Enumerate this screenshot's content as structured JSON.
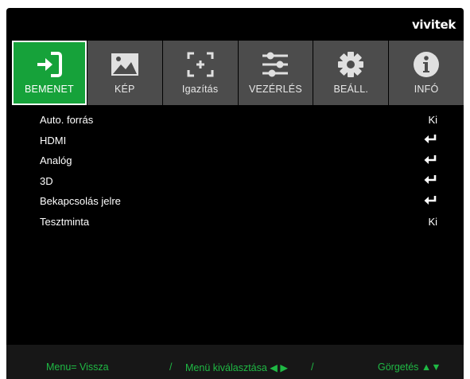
{
  "brand": "vivitek",
  "tabs": [
    {
      "label": "BEMENET",
      "icon": "input-arrow-icon",
      "active": true
    },
    {
      "label": "KÉP",
      "icon": "image-icon",
      "active": false
    },
    {
      "label": "Igazítás",
      "icon": "alignment-icon",
      "active": false
    },
    {
      "label": "VEZÉRLÉS",
      "icon": "sliders-icon",
      "active": false
    },
    {
      "label": "BEÁLL.",
      "icon": "gear-icon",
      "active": false
    },
    {
      "label": "INFÓ",
      "icon": "info-icon",
      "active": false
    }
  ],
  "menu_items": [
    {
      "label": "Auto. forrás",
      "value": "Ki"
    },
    {
      "label": "HDMI",
      "value": "↵"
    },
    {
      "label": "Analóg",
      "value": "↵"
    },
    {
      "label": "3D",
      "value": "↵"
    },
    {
      "label": "Bekapcsolás jelre",
      "value": "↵"
    },
    {
      "label": "Tesztminta",
      "value": "Ki"
    }
  ],
  "footer": {
    "back": "Menu= Vissza",
    "sep1": "/",
    "select": "Menü kiválasztása ◀ ▶",
    "sep2": "/",
    "scroll": "Görgetés ▲▼"
  },
  "colors": {
    "accent": "#16a23a",
    "footer_text": "#1fb944",
    "tab_bg": "#4c4c4c",
    "background": "#000000"
  }
}
